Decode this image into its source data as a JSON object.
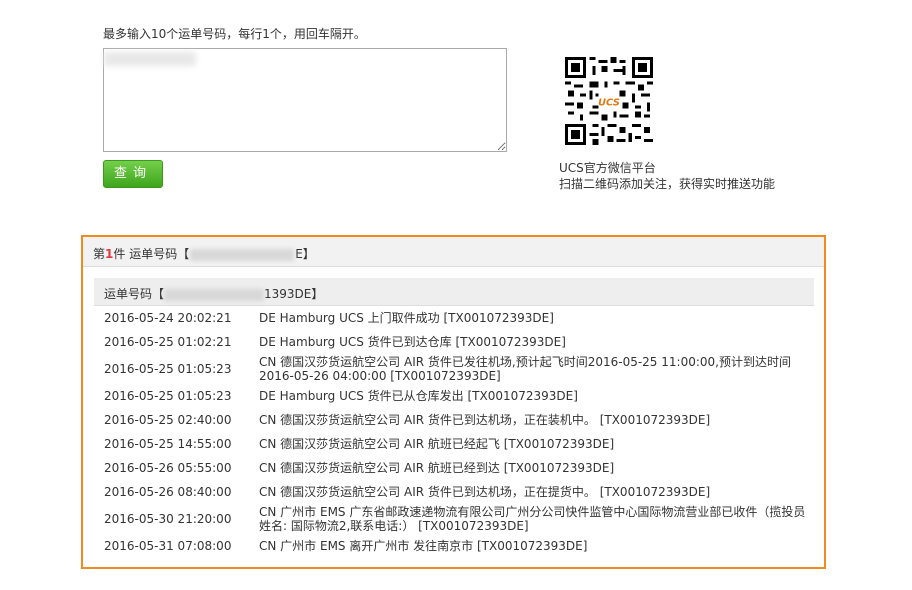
{
  "form": {
    "hint": "最多输入10个运单号码，每行1个，用回车隔开。",
    "textarea_value": "",
    "query_label": "查询"
  },
  "qr": {
    "caption1": "UCS官方微信平台",
    "caption2": "扫描二维码添加关注，获得实时推送功能"
  },
  "result": {
    "title_prefix": "第",
    "title_index": "1",
    "title_suffix": "件 运单号码【",
    "title_tail": "E】",
    "sub_prefix": "运单号码【",
    "sub_tail": "1393DE】",
    "events": [
      {
        "time": "2016-05-24 20:02:21",
        "desc": "DE Hamburg UCS 上门取件成功 [TX001072393DE]"
      },
      {
        "time": "2016-05-25 01:02:21",
        "desc": "DE Hamburg UCS 货件已到达仓库 [TX001072393DE]"
      },
      {
        "time": "2016-05-25 01:05:23",
        "desc": "CN 德国汉莎货运航空公司 AIR 货件已发往机场,预计起飞时间2016-05-25 11:00:00,预计到达时间2016-05-26 04:00:00 [TX001072393DE]"
      },
      {
        "time": "2016-05-25 01:05:23",
        "desc": "DE Hamburg UCS 货件已从仓库发出 [TX001072393DE]"
      },
      {
        "time": "2016-05-25 02:40:00",
        "desc": "CN 德国汉莎货运航空公司 AIR 货件已到达机场，正在装机中。 [TX001072393DE]"
      },
      {
        "time": "2016-05-25 14:55:00",
        "desc": "CN 德国汉莎货运航空公司 AIR 航班已经起飞 [TX001072393DE]"
      },
      {
        "time": "2016-05-26 05:55:00",
        "desc": "CN 德国汉莎货运航空公司 AIR 航班已经到达 [TX001072393DE]"
      },
      {
        "time": "2016-05-26 08:40:00",
        "desc": "CN 德国汉莎货运航空公司 AIR 货件已到达机场，正在提货中。 [TX001072393DE]"
      },
      {
        "time": "2016-05-30 21:20:00",
        "desc": "CN 广州市 EMS 广东省邮政速递物流有限公司广州分公司快件监管中心国际物流营业部已收件（揽投员姓名: 国际物流2,联系电话:） [TX001072393DE]"
      },
      {
        "time": "2016-05-31 07:08:00",
        "desc": "CN 广州市 EMS 离开广州市 发往南京市 [TX001072393DE]"
      }
    ]
  },
  "colors": {
    "accent": "#f08c1e",
    "button": "#4cb82a",
    "highlight": "#e4393c"
  }
}
